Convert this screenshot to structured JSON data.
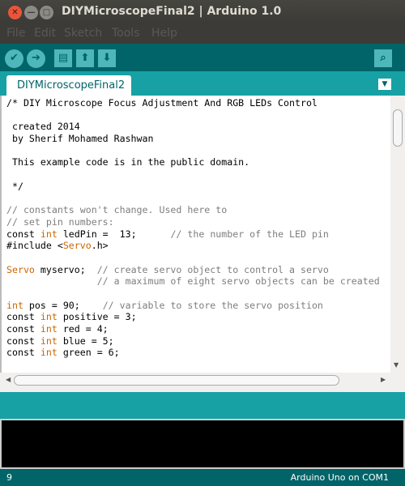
{
  "window": {
    "title": "DIYMicroscopeFinal2 | Arduino 1.0"
  },
  "menu": [
    "File",
    "Edit",
    "Sketch",
    "Tools",
    "Help"
  ],
  "toolbar": {
    "verify": "verify-icon",
    "upload": "upload-icon",
    "new": "new-icon",
    "open": "open-icon",
    "save": "save-icon",
    "serial_monitor": "serial-monitor-icon"
  },
  "tab": {
    "label": "DIYMicroscopeFinal2"
  },
  "colors": {
    "toolbar": "#006468",
    "tabbar": "#17a1a5",
    "keyword": "#cc6600",
    "comment": "#7e7e7e"
  },
  "code": [
    [
      [
        "/* DIY Microscope Focus Adjustment And RGB LEDs Control",
        ""
      ]
    ],
    [],
    [
      [
        " created 2014",
        ""
      ]
    ],
    [
      [
        " by Sherif Mohamed Rashwan",
        ""
      ]
    ],
    [],
    [
      [
        " This example code is in the public domain.",
        ""
      ]
    ],
    [],
    [
      [
        " */",
        ""
      ]
    ],
    [],
    [
      [
        "// constants won't change. Used here to",
        "c"
      ]
    ],
    [
      [
        "// set pin numbers:",
        "c"
      ]
    ],
    [
      [
        "const ",
        ""
      ],
      [
        "int",
        "k"
      ],
      [
        " ledPin =  13;      ",
        ""
      ],
      [
        "// the number of the LED pin",
        "c"
      ]
    ],
    [
      [
        "#include <",
        ""
      ],
      [
        "Servo",
        "k"
      ],
      [
        ".h>",
        ""
      ]
    ],
    [],
    [
      [
        "Servo",
        "k"
      ],
      [
        " myservo;  ",
        ""
      ],
      [
        "// create servo object to control a servo",
        "c"
      ]
    ],
    [
      [
        "                ",
        ""
      ],
      [
        "// a maximum of eight servo objects can be created",
        "c"
      ]
    ],
    [],
    [
      [
        "int",
        "k"
      ],
      [
        " pos = 90;    ",
        ""
      ],
      [
        "// variable to store the servo position",
        "c"
      ]
    ],
    [
      [
        "const ",
        ""
      ],
      [
        "int",
        "k"
      ],
      [
        " positive = 3;",
        ""
      ]
    ],
    [
      [
        "const ",
        ""
      ],
      [
        "int",
        "k"
      ],
      [
        " red = 4;",
        ""
      ]
    ],
    [
      [
        "const ",
        ""
      ],
      [
        "int",
        "k"
      ],
      [
        " blue = 5;",
        ""
      ]
    ],
    [
      [
        "const ",
        ""
      ],
      [
        "int",
        "k"
      ],
      [
        " green = 6;",
        ""
      ]
    ]
  ],
  "status": {
    "line": "9",
    "board": "Arduino Uno on COM1"
  }
}
